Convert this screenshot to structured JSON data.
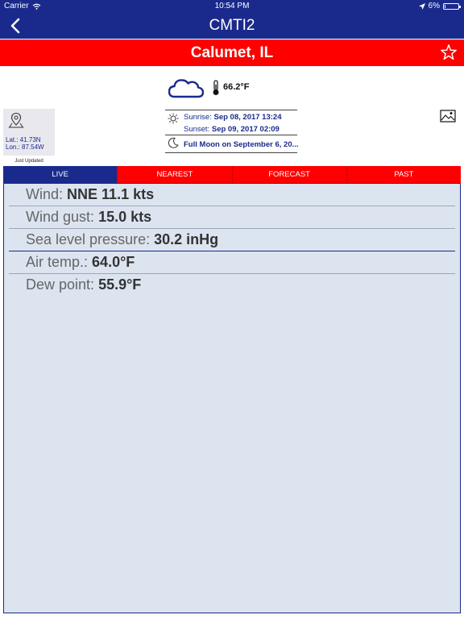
{
  "status": {
    "carrier": "Carrier",
    "time": "10:54 PM",
    "battery": "6%",
    "battery_level": 0.06
  },
  "nav": {
    "title": "CMTI2"
  },
  "station": {
    "name": "Calumet, IL"
  },
  "weather": {
    "temp": "66.2°F"
  },
  "location": {
    "lat": "Lat.:  41.73N",
    "lon": "Lon.:  87.54W",
    "updated": "Just Updated"
  },
  "sun": {
    "sunrise_label": "Sunrise:",
    "sunrise_value": "Sep 08, 2017 13:24",
    "sunset_label": "Sunset:",
    "sunset_value": "Sep 09, 2017 02:09",
    "moon": "Full Moon on September 6, 20..."
  },
  "tabs": [
    "LIVE",
    "NEAREST",
    "FORECAST",
    "PAST"
  ],
  "rows": [
    {
      "label": "Wind:",
      "value": "NNE 11.1 kts"
    },
    {
      "label": "Wind gust:",
      "value": "15.0 kts"
    },
    {
      "label": "Sea level pressure:",
      "value": "30.2 inHg"
    },
    {
      "label": "Air temp.:",
      "value": "64.0°F"
    },
    {
      "label": "Dew point:",
      "value": "55.9°F"
    }
  ],
  "colors": {
    "navy": "#1a2a8c",
    "red": "#fe0000",
    "panel": "#dce4f0"
  }
}
